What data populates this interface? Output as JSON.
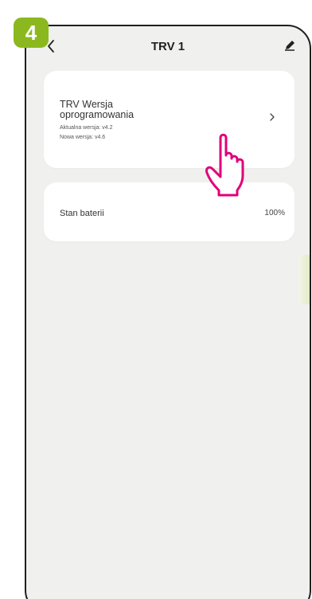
{
  "step": {
    "number": "4"
  },
  "header": {
    "title": "TRV 1",
    "back_icon": "chevron-left-icon",
    "edit_icon": "pencil-icon"
  },
  "firmware": {
    "title_line1": "TRV Wersja",
    "title_line2": "oprogramowania",
    "current_version": "Aktualna wersja: v4.2",
    "new_version": "Nowa wersja: v4.6",
    "arrow": "›"
  },
  "battery": {
    "label": "Stan baterii",
    "value": "100%"
  },
  "colors": {
    "step_badge": "#8cb81f",
    "pointer_hand": "#e0007a",
    "background": "#f0f0ee",
    "card": "#ffffff"
  }
}
